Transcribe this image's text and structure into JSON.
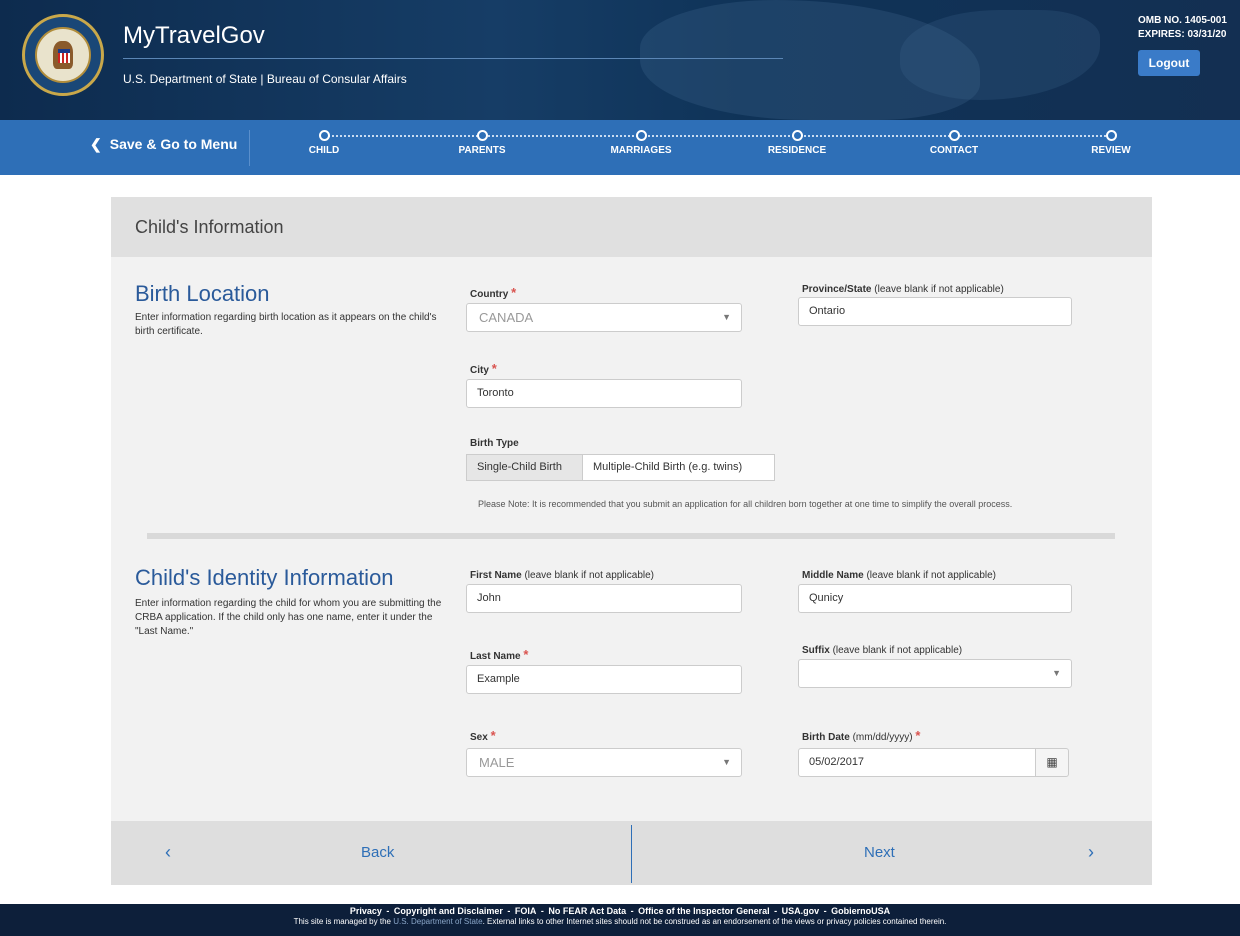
{
  "header": {
    "title": "MyTravelGov",
    "subtitle": "U.S. Department of State | Bureau of Consular Affairs",
    "omb_line1": "OMB NO. 1405-001",
    "omb_line2": "EXPIRES: 03/31/20",
    "logout_label": "Logout"
  },
  "nav": {
    "save_label": "Save & Go to Menu",
    "steps": [
      "CHILD",
      "PARENTS",
      "MARRIAGES",
      "RESIDENCE",
      "CONTACT",
      "REVIEW"
    ]
  },
  "card": {
    "title": "Child's Information"
  },
  "birth_location": {
    "title": "Birth Location",
    "desc": "Enter information regarding birth location as it appears on the child's birth certificate.",
    "country_label": "Country",
    "country_value": "CANADA",
    "province_label": "Province/State",
    "province_note": "(leave blank if not applicable)",
    "province_value": "Ontario",
    "city_label": "City",
    "city_value": "Toronto",
    "birth_type_label": "Birth Type",
    "birth_type_options": [
      "Single-Child Birth",
      "Multiple-Child Birth (e.g. twins)"
    ],
    "note": "Please Note: It is recommended that you submit an application for all children born together at one time to simplify the overall process."
  },
  "identity": {
    "title": "Child's Identity Information",
    "desc": "Enter information regarding the child for whom you are submitting the CRBA application. If the child only has one name, enter it under the \"Last Name.\"",
    "first_label": "First Name",
    "first_note": "(leave blank if not applicable)",
    "first_value": "John",
    "middle_label": "Middle Name",
    "middle_note": "(leave blank if not applicable)",
    "middle_value": "Qunicy",
    "last_label": "Last Name",
    "last_value": "Example",
    "suffix_label": "Suffix",
    "suffix_note": "(leave blank if not applicable)",
    "suffix_value": "",
    "sex_label": "Sex",
    "sex_value": "MALE",
    "birthdate_label": "Birth Date",
    "birthdate_note": "(mm/dd/yyyy)",
    "birthdate_value": "05/02/2017"
  },
  "buttons": {
    "back": "Back",
    "next": "Next"
  },
  "footer": {
    "links": [
      "Privacy",
      "Copyright and Disclaimer",
      "FOIA",
      "No FEAR Act Data",
      "Office of the Inspector General",
      "USA.gov",
      "GobiernoUSA"
    ],
    "managed_prefix": "This site is managed by the",
    "managed_link": "U.S. Department of State",
    "managed_suffix": ". External links to other Internet sites should not be construed as an endorsement of the views or privacy policies contained therein."
  }
}
